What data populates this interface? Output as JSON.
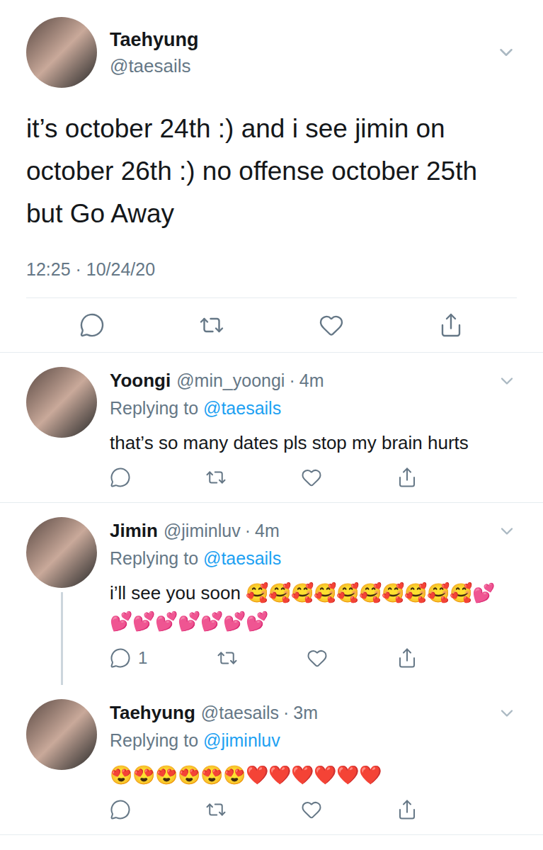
{
  "tweet": {
    "name": "Taehyung",
    "handle": "@taesails",
    "text": "it’s october 24th :) and i see jimin on october 26th :) no offense october 25th but Go Away",
    "timestamp": "12:25 · 10/24/20"
  },
  "separator": "·",
  "replies": [
    {
      "name": "Yoongi",
      "handle": "@min_yoongi",
      "time": "4m",
      "replying_label": "Replying to",
      "replying_to": "@taesails",
      "text": "that’s so many dates pls stop my brain hurts",
      "reply_count": "",
      "thread_continues": false
    },
    {
      "name": "Jimin",
      "handle": "@jiminluv",
      "time": "4m",
      "replying_label": "Replying to",
      "replying_to": "@taesails",
      "text": "i’ll see you soon 🥰🥰🥰🥰🥰🥰🥰🥰🥰🥰💕💕💕💕💕💕💕💕",
      "reply_count": "1",
      "thread_continues": true
    },
    {
      "name": "Taehyung",
      "handle": "@taesails",
      "time": "3m",
      "replying_label": "Replying to",
      "replying_to": "@jiminluv",
      "text": "😍😍😍😍😍😍❤️❤️❤️❤️❤️❤️",
      "reply_count": "",
      "thread_continues": false
    }
  ]
}
